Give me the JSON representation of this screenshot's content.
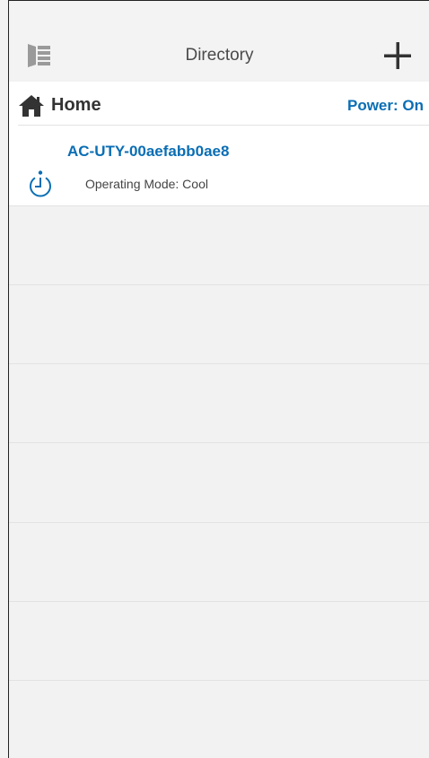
{
  "header": {
    "title": "Directory",
    "menu_icon": "sidebar-menu-icon",
    "add_icon": "plus-icon"
  },
  "group": {
    "icon": "home-icon",
    "name": "Home",
    "power_status": "Power: On"
  },
  "device": {
    "name": "AC-UTY-00aefabb0ae8",
    "timer_icon": "timer-icon",
    "mode_text": "Operating Mode: Cool"
  },
  "colors": {
    "accent": "#0a6eb4",
    "background": "#f2f2f2",
    "panel": "#ffffff",
    "icon_gray": "#9a9a9a",
    "text_dark": "#333333"
  }
}
